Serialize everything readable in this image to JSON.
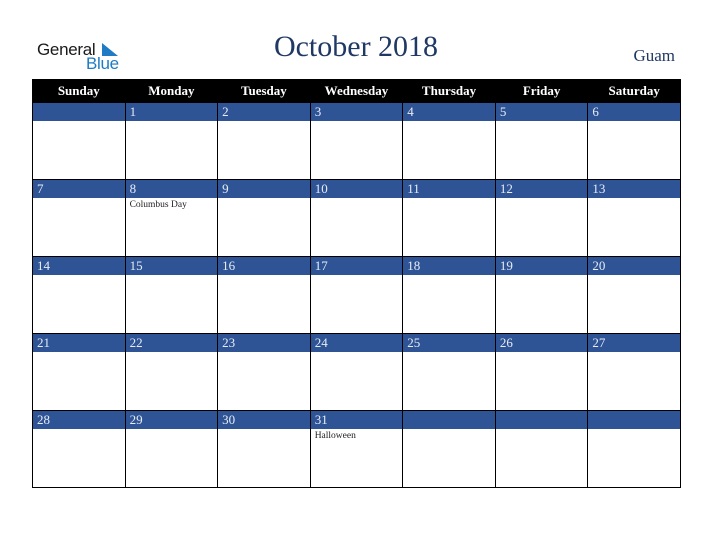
{
  "logo": {
    "line1": "General",
    "line2": "Blue",
    "icon": "triangle-flag-icon"
  },
  "title": "October 2018",
  "country": "Guam",
  "weekdays": [
    "Sunday",
    "Monday",
    "Tuesday",
    "Wednesday",
    "Thursday",
    "Friday",
    "Saturday"
  ],
  "weeks": [
    [
      {
        "day": "",
        "event": ""
      },
      {
        "day": "1",
        "event": ""
      },
      {
        "day": "2",
        "event": ""
      },
      {
        "day": "3",
        "event": ""
      },
      {
        "day": "4",
        "event": ""
      },
      {
        "day": "5",
        "event": ""
      },
      {
        "day": "6",
        "event": ""
      }
    ],
    [
      {
        "day": "7",
        "event": ""
      },
      {
        "day": "8",
        "event": "Columbus Day"
      },
      {
        "day": "9",
        "event": ""
      },
      {
        "day": "10",
        "event": ""
      },
      {
        "day": "11",
        "event": ""
      },
      {
        "day": "12",
        "event": ""
      },
      {
        "day": "13",
        "event": ""
      }
    ],
    [
      {
        "day": "14",
        "event": ""
      },
      {
        "day": "15",
        "event": ""
      },
      {
        "day": "16",
        "event": ""
      },
      {
        "day": "17",
        "event": ""
      },
      {
        "day": "18",
        "event": ""
      },
      {
        "day": "19",
        "event": ""
      },
      {
        "day": "20",
        "event": ""
      }
    ],
    [
      {
        "day": "21",
        "event": ""
      },
      {
        "day": "22",
        "event": ""
      },
      {
        "day": "23",
        "event": ""
      },
      {
        "day": "24",
        "event": ""
      },
      {
        "day": "25",
        "event": ""
      },
      {
        "day": "26",
        "event": ""
      },
      {
        "day": "27",
        "event": ""
      }
    ],
    [
      {
        "day": "28",
        "event": ""
      },
      {
        "day": "29",
        "event": ""
      },
      {
        "day": "30",
        "event": ""
      },
      {
        "day": "31",
        "event": "Halloween"
      },
      {
        "day": "",
        "event": ""
      },
      {
        "day": "",
        "event": ""
      },
      {
        "day": "",
        "event": ""
      }
    ]
  ],
  "colors": {
    "header_bg": "#000000",
    "day_bar": "#2e5496",
    "title": "#1f3864",
    "logo_blue": "#1e7bc4"
  }
}
